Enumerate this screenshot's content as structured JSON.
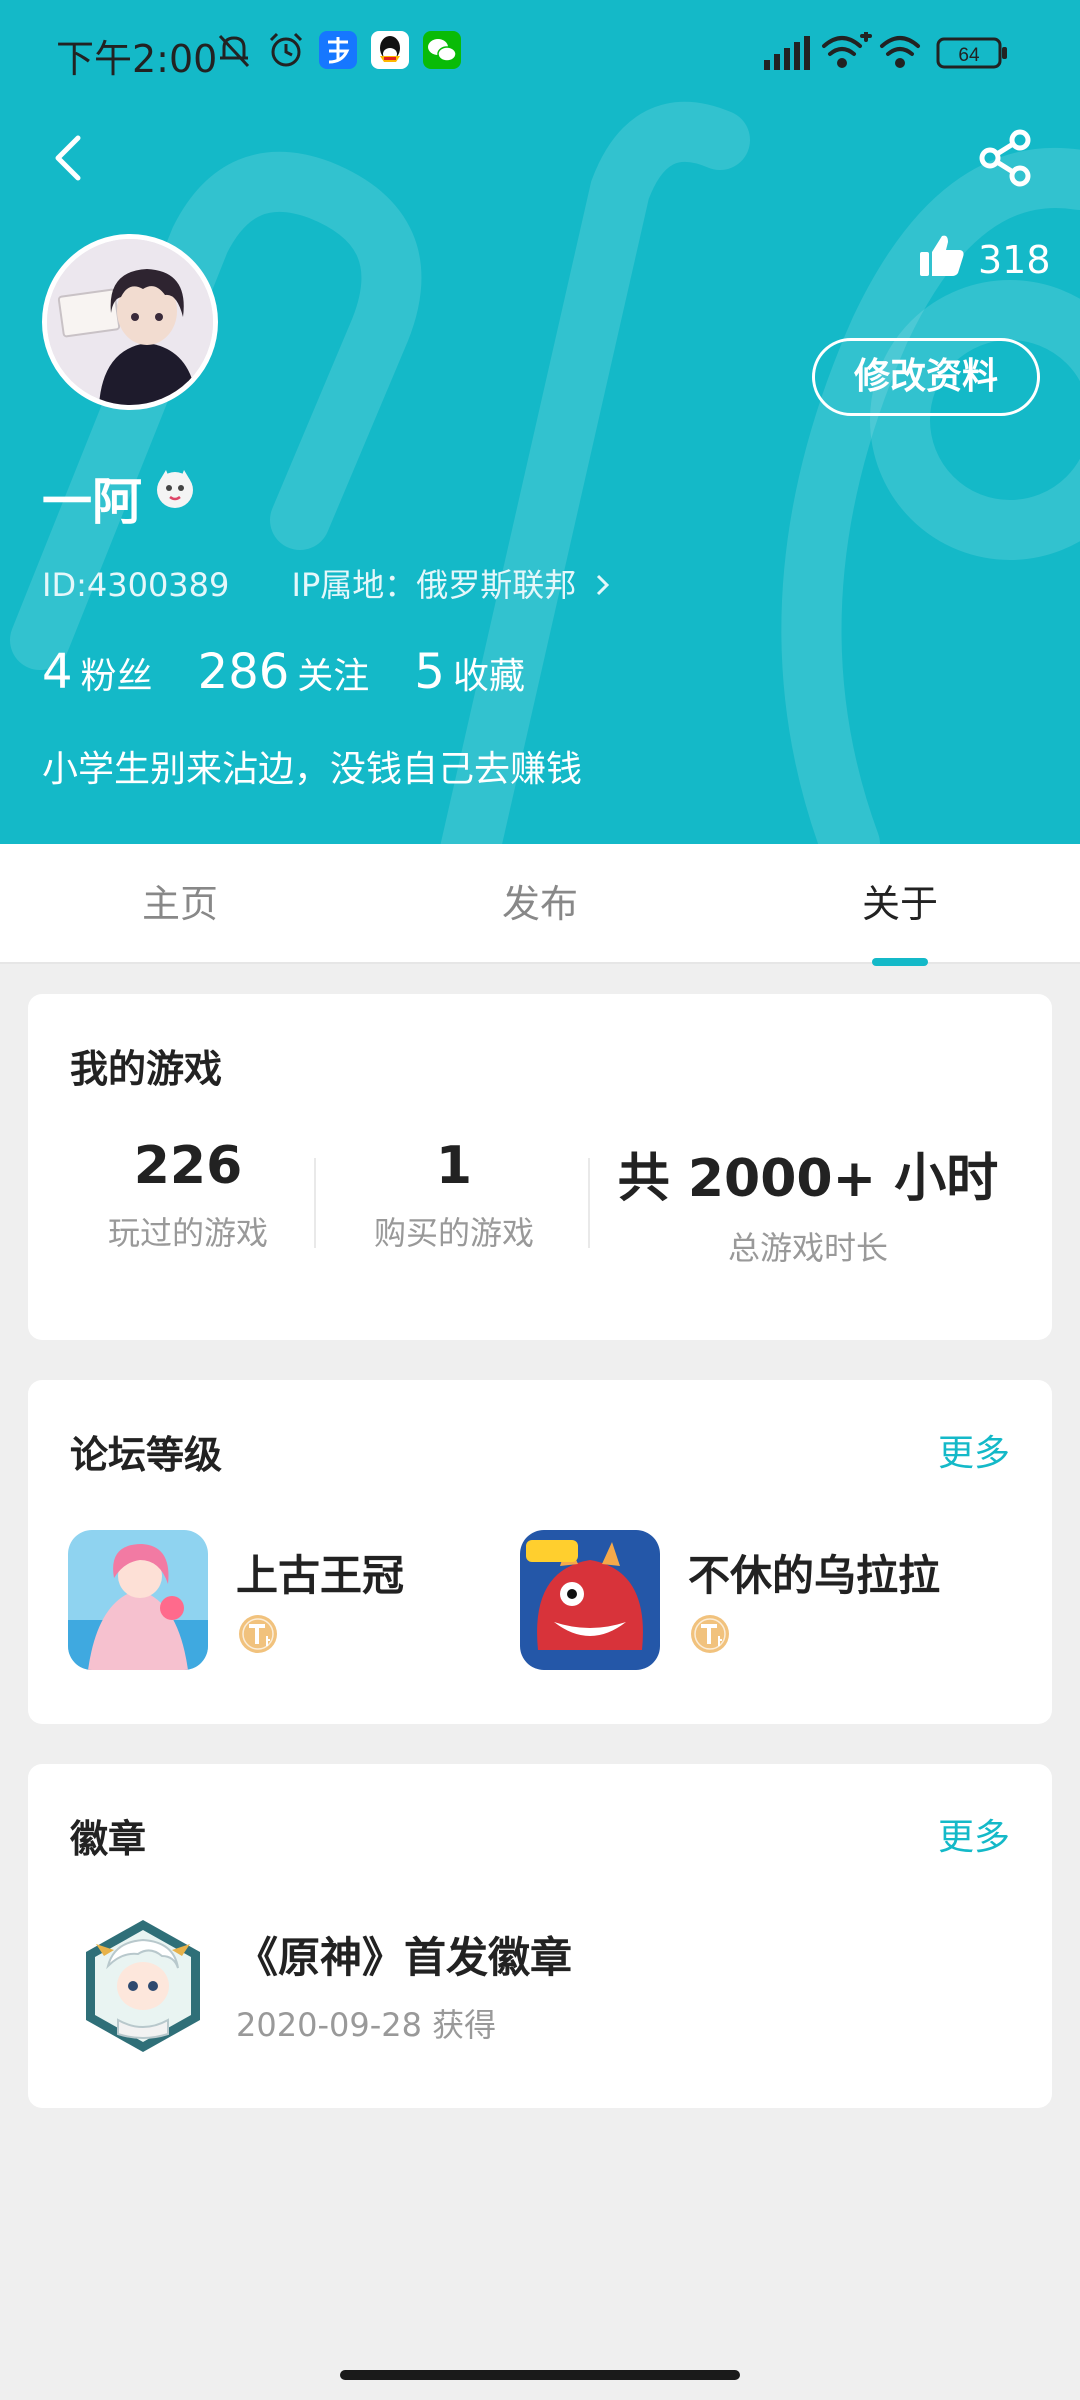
{
  "status_bar": {
    "time": "下午2:00",
    "battery": "64"
  },
  "profile": {
    "likes": "318",
    "edit_label": "修改资料",
    "username": "一阿",
    "id": "ID:4300389",
    "ip": "IP属地：俄罗斯联邦",
    "stats": [
      {
        "num": "4",
        "label": "粉丝"
      },
      {
        "num": "286",
        "label": "关注"
      },
      {
        "num": "5",
        "label": "收藏"
      }
    ],
    "bio": "小学生别来沾边，没钱自己去赚钱"
  },
  "tabs": [
    {
      "label": "主页",
      "active": false
    },
    {
      "label": "发布",
      "active": false
    },
    {
      "label": "关于",
      "active": true
    }
  ],
  "my_games": {
    "title": "我的游戏",
    "stats": [
      {
        "value": "226",
        "label": "玩过的游戏"
      },
      {
        "value": "1",
        "label": "购买的游戏"
      },
      {
        "value": "共 2000+ 小时",
        "label": "总游戏时长"
      }
    ]
  },
  "forum_level": {
    "title": "论坛等级",
    "more": "更多",
    "games": [
      {
        "name": "上古王冠",
        "level": "T4"
      },
      {
        "name": "不休的乌拉拉",
        "level": "T4"
      }
    ]
  },
  "badges": {
    "title": "徽章",
    "more": "更多",
    "items": [
      {
        "name": "《原神》首发徽章",
        "date": "2020-09-28 获得"
      }
    ]
  },
  "colors": {
    "accent": "#14b9c8",
    "background": "#efefef"
  }
}
